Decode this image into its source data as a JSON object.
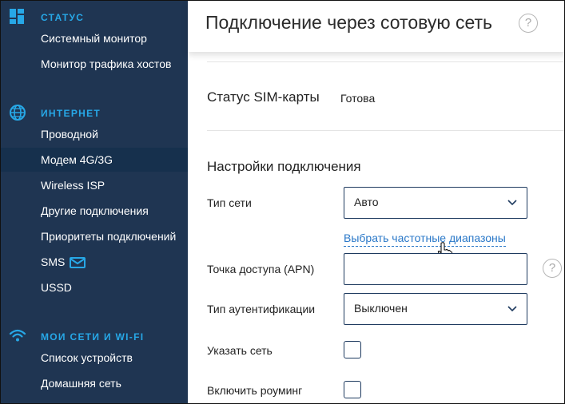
{
  "sidebar": {
    "sections": [
      {
        "title": "СТАТУС",
        "icon": "dashboard-icon",
        "items": [
          {
            "label": "Системный монитор"
          },
          {
            "label": "Монитор трафика хостов"
          }
        ]
      },
      {
        "title": "ИНТЕРНЕТ",
        "icon": "globe-icon",
        "items": [
          {
            "label": "Проводной"
          },
          {
            "label": "Модем 4G/3G",
            "active": true
          },
          {
            "label": "Wireless ISP"
          },
          {
            "label": "Другие подключения"
          },
          {
            "label": "Приоритеты подключений"
          },
          {
            "label": "SMS",
            "icon": "mail-icon"
          },
          {
            "label": "USSD"
          }
        ]
      },
      {
        "title": "МОИ СЕТИ И WI-FI",
        "icon": "wifi-icon",
        "items": [
          {
            "label": "Список устройств"
          },
          {
            "label": "Домашняя сеть"
          }
        ]
      }
    ]
  },
  "main": {
    "title": "Подключение через сотовую сеть",
    "help_glyph": "?",
    "sim": {
      "label": "Статус SIM-карты",
      "value": "Готова"
    },
    "settings": {
      "heading": "Настройки подключения",
      "network_type": {
        "label": "Тип сети",
        "value": "Авто"
      },
      "freq_link": "Выбрать частотные диапазоны",
      "apn": {
        "label": "Точка доступа (APN)",
        "value": ""
      },
      "auth": {
        "label": "Тип аутентификации",
        "value": "Выключен"
      },
      "specify_network": {
        "label": "Указать сеть",
        "checked": false
      },
      "roaming": {
        "label": "Включить роуминг",
        "checked": false
      }
    }
  },
  "colors": {
    "sidebar_bg": "#1f3552",
    "sidebar_active": "#16304d",
    "accent": "#27a8e7",
    "link": "#2a78c8",
    "field_border": "#1e3a5f"
  }
}
